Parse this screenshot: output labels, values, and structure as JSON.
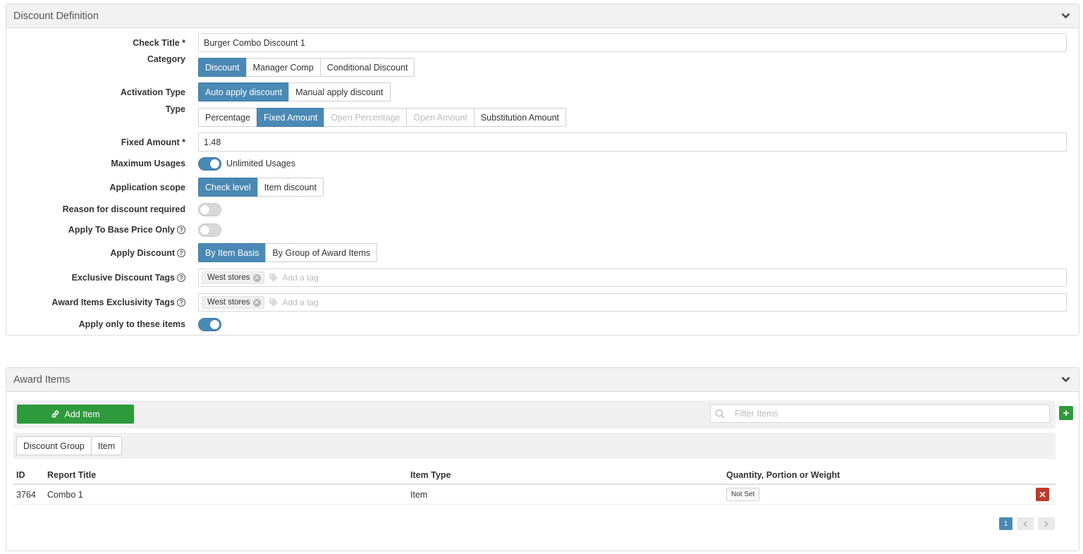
{
  "definition": {
    "title": "Discount Definition",
    "check_title": {
      "label": "Check Title *",
      "value": "Burger Combo Discount 1"
    },
    "category": {
      "label": "Category",
      "options": [
        "Discount",
        "Manager Comp",
        "Conditional Discount"
      ],
      "selected": "Discount"
    },
    "activation_type": {
      "label": "Activation Type",
      "options": [
        "Auto apply discount",
        "Manual apply discount"
      ],
      "selected": "Auto apply discount"
    },
    "type": {
      "label": "Type",
      "options": [
        "Percentage",
        "Fixed Amount",
        "Open Percentage",
        "Open Amount",
        "Substitution Amount"
      ],
      "selected": "Fixed Amount",
      "disabled": [
        "Open Percentage",
        "Open Amount"
      ]
    },
    "fixed_amount": {
      "label": "Fixed Amount *",
      "value": "1.48"
    },
    "maximum_usages": {
      "label": "Maximum Usages",
      "toggle_on": true,
      "toggle_text": "Unlimited Usages"
    },
    "application_scope": {
      "label": "Application scope",
      "options": [
        "Check level",
        "Item discount"
      ],
      "selected": "Check level"
    },
    "reason_required": {
      "label": "Reason for discount required",
      "toggle_on": false
    },
    "base_price_only": {
      "label": "Apply To Base Price Only",
      "toggle_on": false
    },
    "apply_discount": {
      "label": "Apply Discount",
      "options": [
        "By Item Basis",
        "By Group of Award Items"
      ],
      "selected": "By Item Basis"
    },
    "exclusive_tags": {
      "label": "Exclusive Discount Tags",
      "tags": [
        "West stores"
      ],
      "placeholder": "Add a tag"
    },
    "award_exclusivity_tags": {
      "label": "Award Items Exclusivity Tags",
      "tags": [
        "West stores"
      ],
      "placeholder": "Add a tag"
    },
    "apply_only_items": {
      "label": "Apply only to these items",
      "toggle_on": true
    }
  },
  "award": {
    "title": "Award Items",
    "add_item_label": "Add Item",
    "filter_placeholder": "Filter Items",
    "plus_label": "+",
    "filter_tabs": [
      "Discount Group",
      "Item"
    ],
    "columns": [
      "ID",
      "Report Title",
      "Item Type",
      "Quantity, Portion or Weight"
    ],
    "rows": [
      {
        "id": "3764",
        "report_title": "Combo 1",
        "item_type": "Item",
        "quantity": "Not Set"
      }
    ],
    "pager": {
      "current": "1"
    }
  },
  "colors": {
    "primary": "#4a89b5",
    "success": "#2d9a3c",
    "danger": "#c0392b"
  },
  "icons": {
    "chevron": "chevron-down-icon",
    "help": "help-circle-icon",
    "tag": "tag-icon",
    "link": "link-icon",
    "search": "search-icon",
    "delete": "unlink-icon"
  }
}
